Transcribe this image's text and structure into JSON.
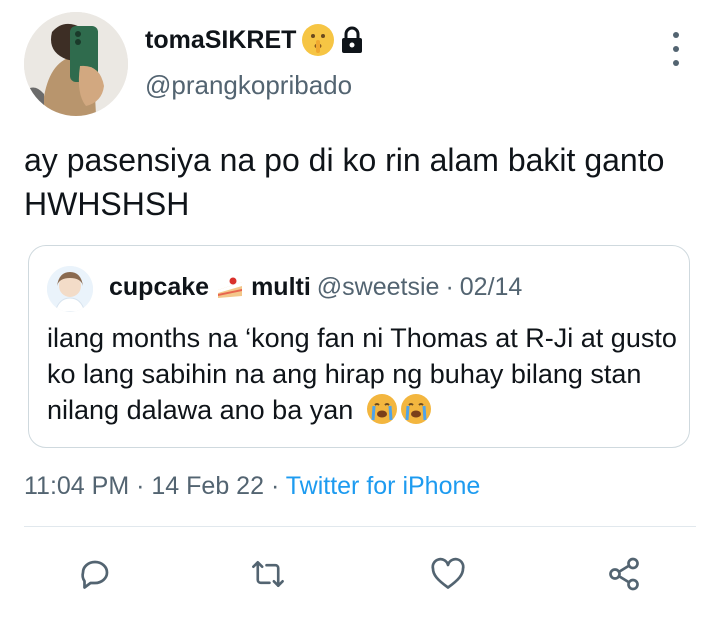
{
  "author": {
    "display_name": "tomaSIKRET",
    "name_emoji_icon": "shushing-face-icon",
    "lock_icon": "lock-icon",
    "handle": "@prangkopribado",
    "avatar_icon": "avatar-photo"
  },
  "tweet": {
    "text": "ay pasensiya na po di ko rin alam bakit ganto HWHSHSH"
  },
  "quoted": {
    "name_part1": "cupcake",
    "name_emoji_icon": "cake-icon",
    "name_part2": "multi",
    "handle": "@sweetsie",
    "separator": "·",
    "date": "02/14",
    "text": "ilang months na ‘kong fan ni Thomas at R-Ji at gusto ko lang sabihin na ang hirap ng buhay bilang stan nilang dalawa ano ba yan",
    "end_emoji_icons": [
      "crying-face-icon",
      "crying-face-icon"
    ]
  },
  "meta": {
    "time": "11:04 PM",
    "sep1": "·",
    "date": "14 Feb 22",
    "sep2": "·",
    "source": "Twitter for iPhone"
  },
  "actions": [
    "reply-icon",
    "retweet-icon",
    "like-icon",
    "share-icon"
  ],
  "colors": {
    "text": "#0f1419",
    "secondary": "#536471",
    "link": "#1d9bf0",
    "border": "#cfd9de"
  }
}
